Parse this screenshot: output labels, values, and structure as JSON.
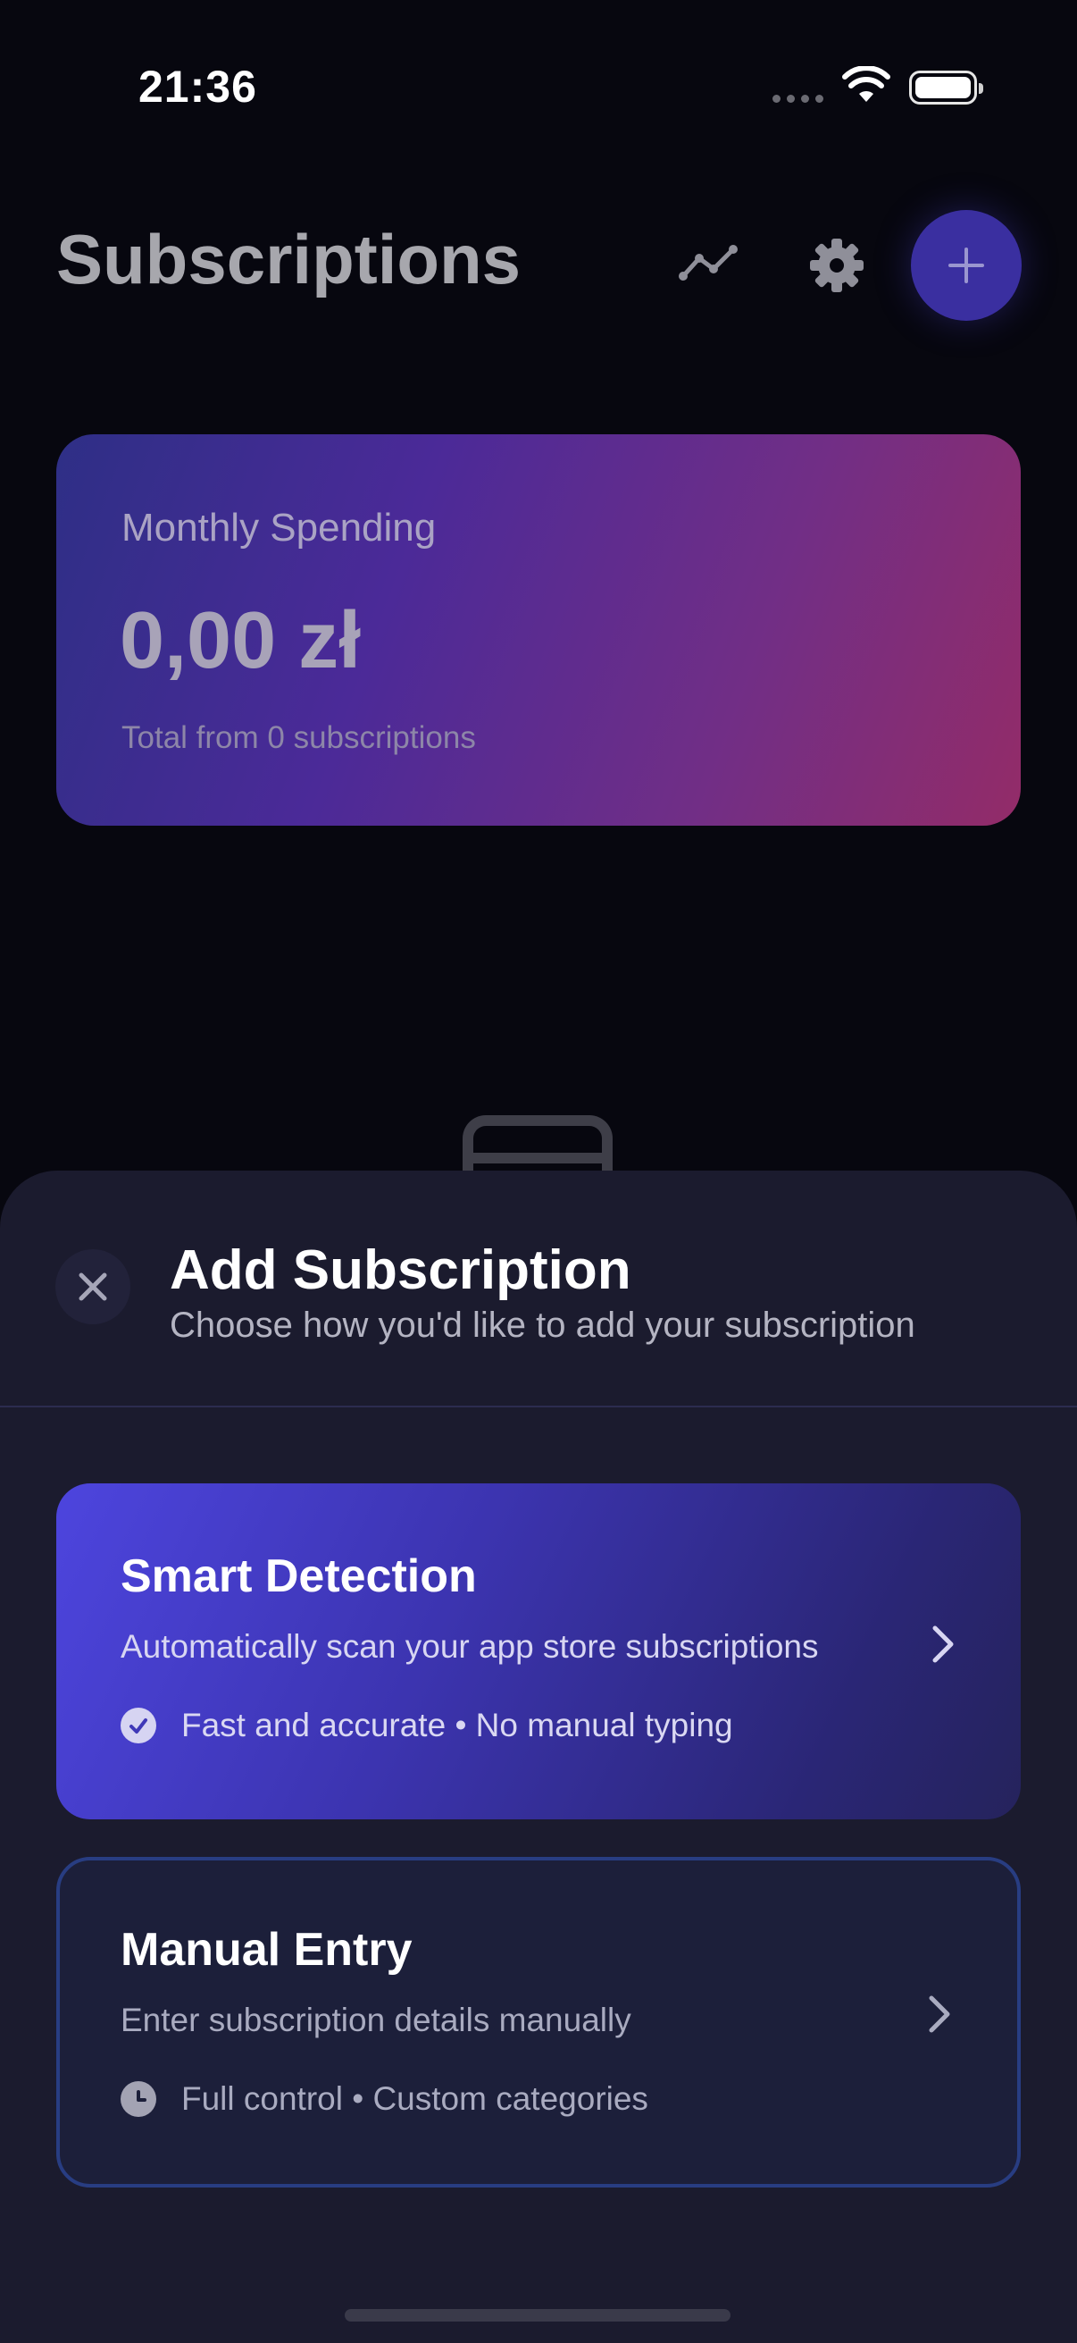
{
  "status_bar": {
    "time": "21:36"
  },
  "header": {
    "title": "Subscriptions"
  },
  "spending": {
    "label": "Monthly Spending",
    "amount": "0,00 zł",
    "subtitle": "Total from 0 subscriptions"
  },
  "sheet": {
    "title": "Add Subscription",
    "subtitle": "Choose how you'd like to add your subscription",
    "options": [
      {
        "title": "Smart Detection",
        "description": "Automatically scan your app store subscriptions",
        "feature": "Fast and accurate • No manual typing",
        "icon": "checkmark-circle-icon"
      },
      {
        "title": "Manual Entry",
        "description": "Enter subscription details manually",
        "feature": "Full control • Custom categories",
        "icon": "clock-icon"
      }
    ]
  },
  "colors": {
    "background": "#07070f",
    "sheet": "#1b1b2e",
    "accent": "#3a2fa0",
    "smart_card_start": "#4d45de",
    "manual_card_border": "#283d82"
  }
}
